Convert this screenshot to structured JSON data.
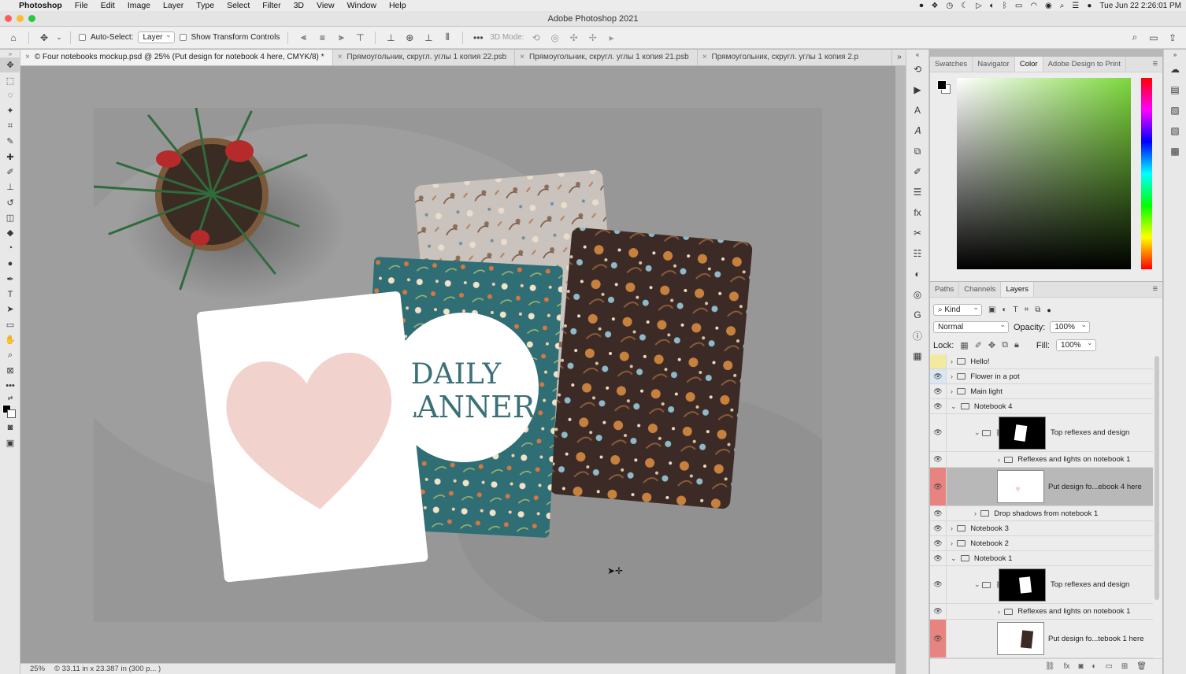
{
  "menubar": {
    "app_name": "Photoshop",
    "items": [
      "File",
      "Edit",
      "Image",
      "Layer",
      "Type",
      "Select",
      "Filter",
      "3D",
      "View",
      "Window",
      "Help"
    ],
    "clock": "Tue Jun 22  2:26:01 PM"
  },
  "window": {
    "title": "Adobe Photoshop 2021"
  },
  "options": {
    "auto_select_label": "Auto-Select:",
    "auto_select_value": "Layer",
    "show_transform_label": "Show Transform Controls",
    "mode_3d_label": "3D Mode:"
  },
  "tabs": [
    {
      "label": "© Four notebooks mockup.psd @ 25% (Put design for notebook 4 here, CMYK/8) *"
    },
    {
      "label": "Прямоугольник, скругл. углы 1 копия 22.psb"
    },
    {
      "label": "Прямоугольник, скругл. углы 1 копия 21.psb"
    },
    {
      "label": "Прямоугольник, скругл. углы 1 копия 2.p"
    }
  ],
  "canvas": {
    "planner_line1": "DAILY",
    "planner_line2": "PLANNER"
  },
  "status": {
    "zoom": "25%",
    "doc_info": "© 33.11 in x 23.387 in (300 p... )"
  },
  "color_panel": {
    "tabs": [
      "Swatches",
      "Navigator",
      "Color",
      "Adobe Design to Print"
    ],
    "active": "Color"
  },
  "layers_panel": {
    "tabs": [
      "Paths",
      "Channels",
      "Layers"
    ],
    "active": "Layers",
    "filter": "Kind",
    "blend_mode": "Normal",
    "opacity_label": "Opacity:",
    "opacity": "100%",
    "lock_label": "Lock:",
    "fill_label": "Fill:",
    "fill": "100%",
    "layers": [
      {
        "name": "Hello!"
      },
      {
        "name": "Flower in a pot"
      },
      {
        "name": "Main light"
      },
      {
        "name": "Notebook 4"
      },
      {
        "name": "Top reflexes and design"
      },
      {
        "name": "Reflexes and lights on notebook 1"
      },
      {
        "name": "Put design fo...ebook 4 here"
      },
      {
        "name": "Drop shadows from notebook 1"
      },
      {
        "name": "Notebook 3"
      },
      {
        "name": "Notebook 2"
      },
      {
        "name": "Notebook 1"
      },
      {
        "name": "Top reflexes and design"
      },
      {
        "name": "Reflexes and lights on notebook 1"
      },
      {
        "name": "Put design fo...tebook 1 here"
      }
    ]
  },
  "colors": {
    "accent_red": "#e8847f",
    "teal_notebook": "#2f6e74",
    "dark_notebook": "#3a2a26",
    "heart_pink": "#f2d2cc"
  }
}
